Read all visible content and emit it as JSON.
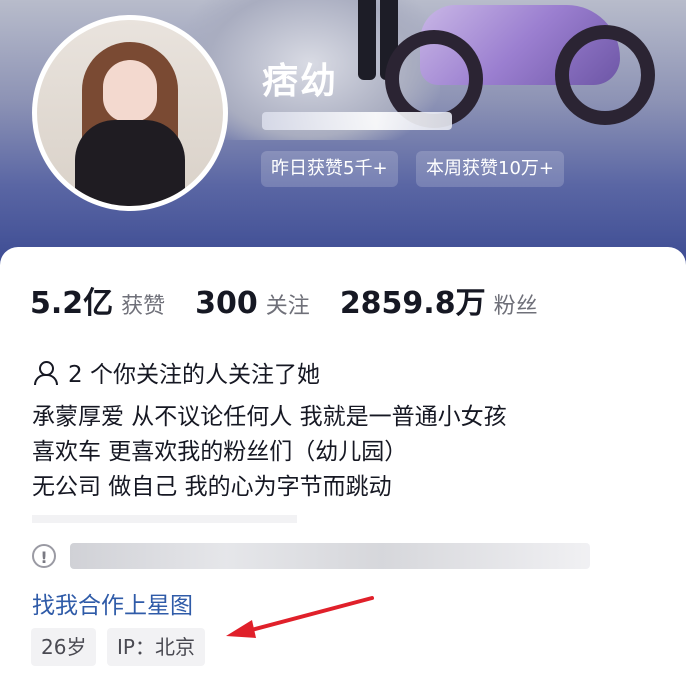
{
  "profile": {
    "name": "痞幼",
    "badges": [
      "昨日获赞5千+",
      "本周获赞10万+"
    ]
  },
  "stats": [
    {
      "value": "5.2亿",
      "label": "获赞"
    },
    {
      "value": "300",
      "label": "关注"
    },
    {
      "value": "2859.8万",
      "label": "粉丝"
    }
  ],
  "mutual": {
    "text": "2 个你关注的人关注了她",
    "icon": "user-icon"
  },
  "bio": {
    "lines": [
      "承蒙厚爱 从不议论任何人 我就是一普通小女孩",
      "喜欢车 更喜欢我的粉丝们（幼儿园）",
      "无公司 做自己 我的心为字节而跳动"
    ]
  },
  "notice": {
    "icon": "info-icon"
  },
  "star_link": "找我合作上星图",
  "tags": [
    "26岁",
    "IP：北京"
  ],
  "colors": {
    "banner": "#4a579b",
    "link": "#2f5ba8",
    "arrow": "#e0202a"
  }
}
